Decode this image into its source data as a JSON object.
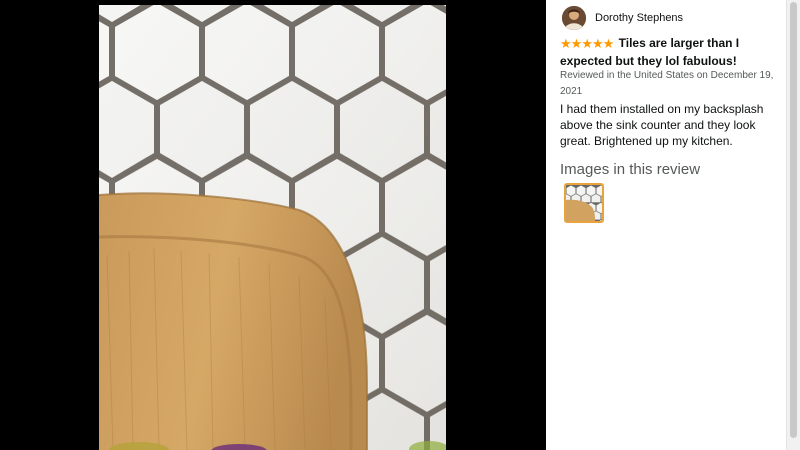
{
  "review": {
    "author_name": "Dorothy Stephens",
    "avatar_icon": "user-avatar-icon",
    "rating": 5,
    "rating_max": 5,
    "star_icon": "star-icon",
    "star_color": "#ff9900",
    "title": "Tiles are larger than I expected but they lol fabulous!",
    "meta": "Reviewed in the United States on December 19, 2021",
    "body": "I had them installed on my backsplash above the sink counter and they look great. Brightened up my kitchen."
  },
  "images_section": {
    "heading": "Images in this review",
    "thumbnail_count": 1,
    "selected_thumbnail": 1,
    "selected_border_color": "#e8a33d"
  },
  "viewer": {
    "background_color": "#000000",
    "image_subject": "white hexagon tile backsplash with wooden cutting board"
  }
}
